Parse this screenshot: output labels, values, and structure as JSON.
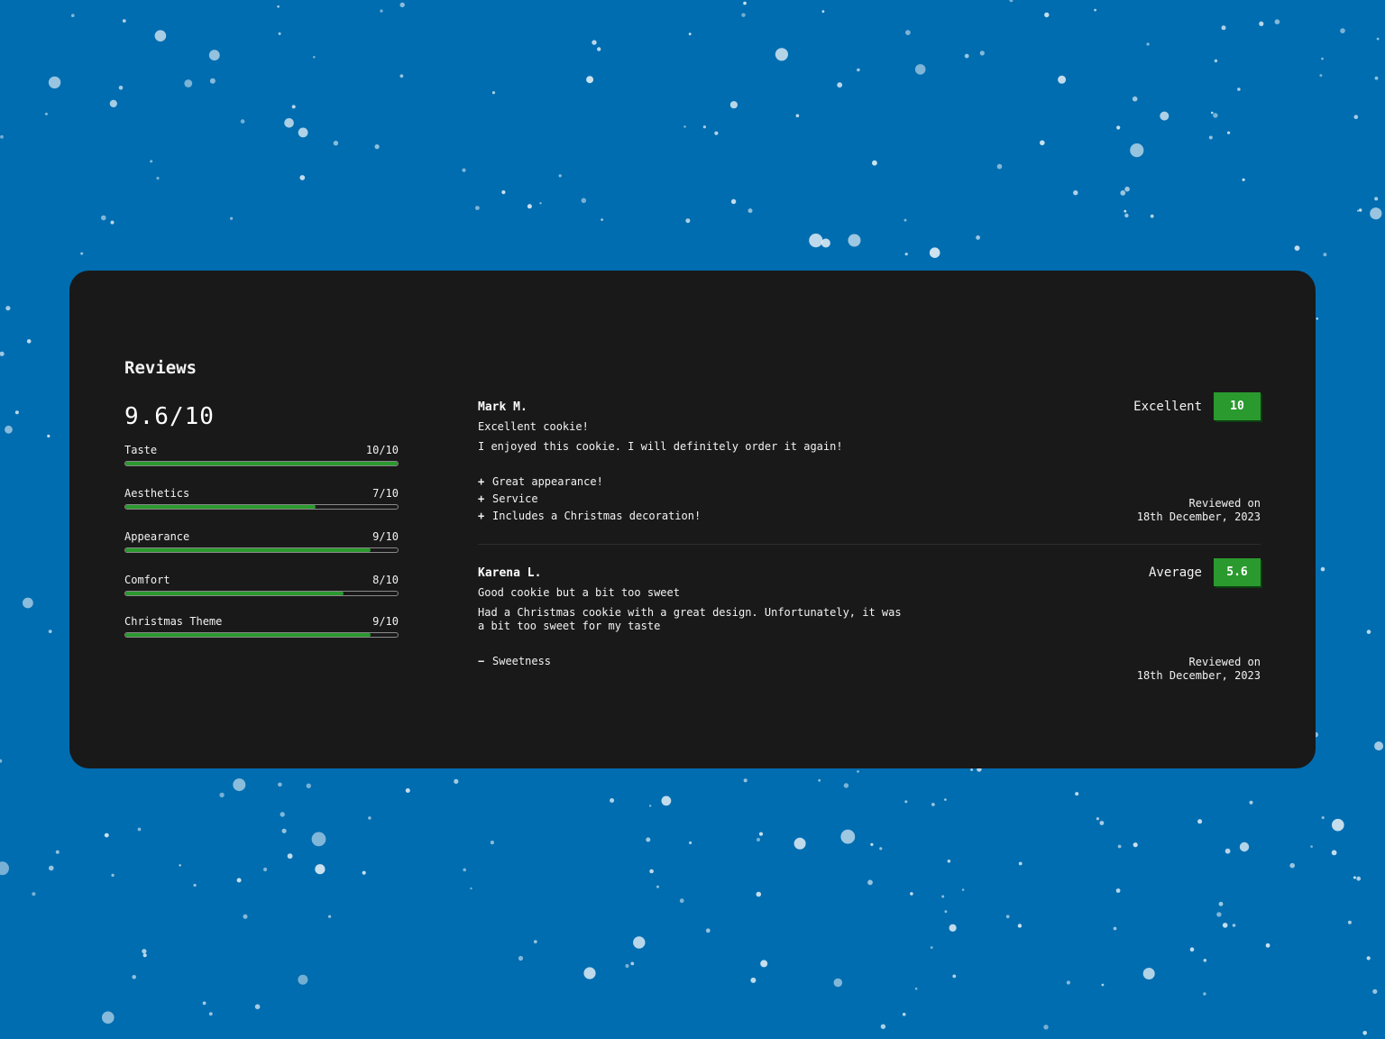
{
  "page": {
    "background_color": "#006db0",
    "card_color": "#191919",
    "accent_color": "#2a9a2e"
  },
  "summary": {
    "heading": "Reviews",
    "overall_score": "9.6/10",
    "metrics": [
      {
        "label": "Taste",
        "score_text": "10/10",
        "value": 10,
        "max": 10
      },
      {
        "label": "Aesthetics",
        "score_text": "7/10",
        "value": 7,
        "max": 10
      },
      {
        "label": "Appearance",
        "score_text": "9/10",
        "value": 9,
        "max": 10
      },
      {
        "label": "Comfort",
        "score_text": "8/10",
        "value": 8,
        "max": 10
      },
      {
        "label": "Christmas Theme",
        "score_text": "9/10",
        "value": 9,
        "max": 10
      }
    ]
  },
  "reviews": [
    {
      "name": "Mark M.",
      "title": "Excellent cookie!",
      "body": "I enjoyed this cookie. I will definitely order it again!",
      "rating_label": "Excellent",
      "score": "10",
      "points": [
        {
          "sign": "+",
          "text": "Great appearance!"
        },
        {
          "sign": "+",
          "text": "Service"
        },
        {
          "sign": "+",
          "text": "Includes a Christmas decoration!"
        }
      ],
      "reviewed_label": "Reviewed on",
      "reviewed_date": "18th December, 2023"
    },
    {
      "name": "Karena L.",
      "title": "Good cookie but a bit too sweet",
      "body": "Had a Christmas cookie with a great design. Unfortunately, it was a bit too sweet for my taste",
      "rating_label": "Average",
      "score": "5.6",
      "points": [
        {
          "sign": "−",
          "text": "Sweetness"
        }
      ],
      "reviewed_label": "Reviewed on",
      "reviewed_date": "18th December, 2023"
    }
  ]
}
